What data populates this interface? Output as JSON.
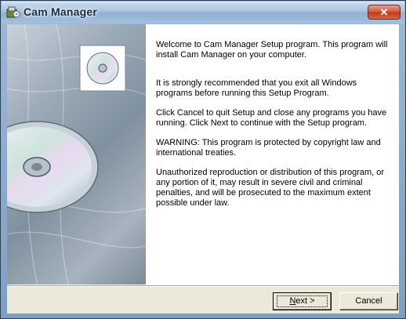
{
  "window": {
    "title": "Cam Manager",
    "close_label": "✕"
  },
  "content": {
    "welcome": "Welcome to Cam Manager Setup program. This program will install Cam Manager on your computer.",
    "recommend": "It is strongly recommended that you exit all Windows programs before running this Setup Program.",
    "cancel_info": "Click Cancel to quit Setup and close any programs you have running.  Click Next to continue with the Setup program.",
    "warning": "WARNING: This program is protected by copyright law and international treaties.",
    "unauthorized": "Unauthorized reproduction or distribution of this program, or any portion of it, may result in severe civil and criminal penalties, and will be prosecuted to the maximum extent possible under law."
  },
  "buttons": {
    "next_mnemonic": "N",
    "next_rest": "ext >",
    "cancel": "Cancel"
  },
  "icons": {
    "title": "setup-app-icon",
    "side_disc": "cd-disc-icon"
  },
  "colors": {
    "titlebar": "#a9c3df",
    "close": "#c23a1e",
    "dialog_face": "#ece9d8"
  }
}
